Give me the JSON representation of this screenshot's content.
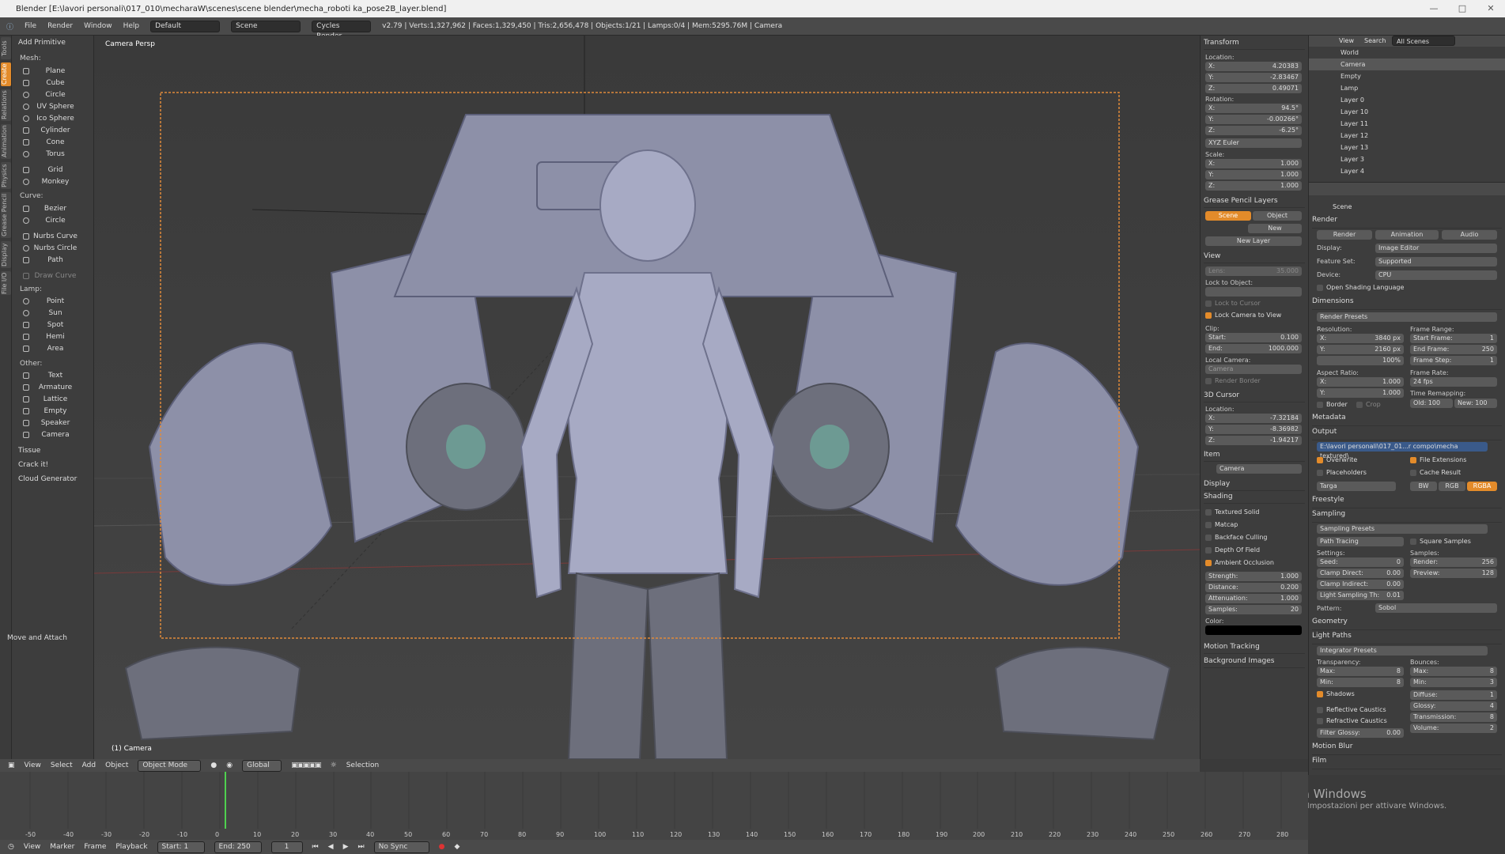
{
  "titlebar": {
    "text": "Blender [E:\\lavori personali\\017_010\\mecharaW\\scenes\\scene blender\\mecha_roboti ka_pose2B_layer.blend]"
  },
  "infobar": {
    "menus": [
      "File",
      "Render",
      "Window",
      "Help"
    ],
    "layout": "Default",
    "scene": "Scene",
    "engine": "Cycles Render",
    "stats": "v2.79 | Verts:1,327,962 | Faces:1,329,450 | Tris:2,656,478 | Objects:1/21 | Lamps:0/4 | Mem:5295.76M | Camera"
  },
  "tooltabs": [
    "Tools",
    "Create",
    "Relations",
    "Animation",
    "Physics",
    "Grease Pencil",
    "Display",
    "File I/O"
  ],
  "toolshelf": {
    "header": "Add Primitive",
    "mesh_label": "Mesh:",
    "mesh": [
      "Plane",
      "Cube",
      "Circle",
      "UV Sphere",
      "Ico Sphere",
      "Cylinder",
      "Cone",
      "Torus",
      "Grid",
      "Monkey"
    ],
    "curve_label": "Curve:",
    "curve": [
      "Bezier",
      "Circle",
      "Nurbs Curve",
      "Nurbs Circle",
      "Path",
      "Draw Curve"
    ],
    "lamp_label": "Lamp:",
    "lamp": [
      "Point",
      "Sun",
      "Spot",
      "Hemi",
      "Area"
    ],
    "other_label": "Other:",
    "other": [
      "Text",
      "Armature",
      "Lattice",
      "Empty",
      "Speaker",
      "Camera"
    ],
    "addons": [
      "Tissue",
      "Crack it!",
      "Cloud Generator"
    ],
    "bottom": "Move and Attach"
  },
  "viewport": {
    "label": "Camera Persp",
    "object": "(1) Camera"
  },
  "viewheader": {
    "items": [
      "View",
      "Select",
      "Add",
      "Object"
    ],
    "mode": "Object Mode",
    "orient": "Global",
    "selection": "Selection"
  },
  "props": {
    "transform": "Transform",
    "location_label": "Location:",
    "loc": [
      "4.20383",
      "-2.83467",
      "0.49071"
    ],
    "rotation_label": "Rotation:",
    "rot": [
      "94.5°",
      "-0.00266°",
      "-6.25°"
    ],
    "euler": "XYZ Euler",
    "scale_label": "Scale:",
    "scale": [
      "1.000",
      "1.000",
      "1.000"
    ],
    "grease": "Grease Pencil Layers",
    "gp_scene": "Scene",
    "gp_object": "Object",
    "gp_new": "New",
    "gp_newlayer": "New Layer",
    "view": "View",
    "lens": "Lens:",
    "lens_val": "35.000",
    "lock_obj": "Lock to Object:",
    "lock_cursor": "Lock to Cursor",
    "lock_cam": "Lock Camera to View",
    "clip": "Clip:",
    "clip_start": "Start:",
    "clip_start_v": "0.100",
    "clip_end": "End:",
    "clip_end_v": "1000.000",
    "local_cam": "Local Camera:",
    "local_cam_v": "Camera",
    "render_border": "Render Border",
    "cursor": "3D Cursor",
    "cursor_loc": "Location:",
    "cur": [
      "-7.32184",
      "-8.36982",
      "-1.94217"
    ],
    "item": "Item",
    "item_name": "Camera",
    "display": "Display",
    "shading": "Shading",
    "shade_opts": [
      "Textured Solid",
      "Matcap",
      "Backface Culling",
      "Depth Of Field",
      "Ambient Occlusion"
    ],
    "ao_strength": "Strength:",
    "ao_strength_v": "1.000",
    "ao_distance": "Distance:",
    "ao_distance_v": "0.200",
    "ao_atten": "Attenuation:",
    "ao_atten_v": "1.000",
    "ao_samples": "Samples:",
    "ao_samples_v": "20",
    "color": "Color:",
    "motion": "Motion Tracking",
    "bg": "Background Images"
  },
  "outliner": {
    "view": "View",
    "search": "Search",
    "scenes": "All Scenes",
    "rows": [
      "World",
      "Camera",
      "Empty",
      "Lamp",
      "Layer 0",
      "Layer 10",
      "Layer 11",
      "Layer 12",
      "Layer 13",
      "Layer 3",
      "Layer 4"
    ]
  },
  "render": {
    "scene": "Scene",
    "render": "Render",
    "btn_render": "Render",
    "btn_anim": "Animation",
    "btn_audio": "Audio",
    "display": "Display:",
    "display_v": "Image Editor",
    "feature": "Feature Set:",
    "feature_v": "Supported",
    "device": "Device:",
    "device_v": "CPU",
    "osl": "Open Shading Language",
    "dimensions": "Dimensions",
    "presets": "Render Presets",
    "resolution": "Resolution:",
    "res_x": "3840 px",
    "res_y": "2160 px",
    "res_pct": "100%",
    "frame_range": "Frame Range:",
    "start_frame": "Start Frame:",
    "start_frame_v": "1",
    "end_frame": "End Frame:",
    "end_frame_v": "250",
    "frame_step": "Frame Step:",
    "frame_step_v": "1",
    "aspect": "Aspect Ratio:",
    "asp_x": "1.000",
    "asp_y": "1.000",
    "frame_rate": "Frame Rate:",
    "fps": "24 fps",
    "remap": "Time Remapping:",
    "old": "Old: 100",
    "new": "New: 100",
    "border": "Border",
    "crop": "Crop",
    "metadata": "Metadata",
    "output": "Output",
    "output_path": "E:\\lavori personali\\017_01...r compo\\mecha textured\\",
    "overwrite": "Overwrite",
    "file_ext": "File Extensions",
    "placeholders": "Placeholders",
    "cache": "Cache Result",
    "format": "Targa",
    "bw": "BW",
    "rgb": "RGB",
    "rgba": "RGBA",
    "freestyle": "Freestyle",
    "sampling": "Sampling",
    "samp_presets": "Sampling Presets",
    "path_tracing": "Path Tracing",
    "square": "Square Samples",
    "settings": "Settings:",
    "samples": "Samples:",
    "seed": "Seed:",
    "seed_v": "0",
    "clamp_d": "Clamp Direct:",
    "clamp_d_v": "0.00",
    "clamp_i": "Clamp Indirect:",
    "clamp_i_v": "0.00",
    "light_th": "Light Sampling Th:",
    "light_th_v": "0.01",
    "s_render": "Render:",
    "s_render_v": "256",
    "s_preview": "Preview:",
    "s_preview_v": "128",
    "pattern": "Pattern:",
    "pattern_v": "Sobol",
    "geometry": "Geometry",
    "light_paths": "Light Paths",
    "int_presets": "Integrator Presets",
    "transparency": "Transparency:",
    "bounces": "Bounces:",
    "t_max": "Max:",
    "t_max_v": "8",
    "t_min": "Min:",
    "t_min_v": "8",
    "b_max": "Max:",
    "b_max_v": "8",
    "b_min": "Min:",
    "b_min_v": "3",
    "shadows": "Shadows",
    "diffuse": "Diffuse:",
    "diffuse_v": "1",
    "glossy": "Glossy:",
    "glossy_v": "4",
    "transmission": "Transmission:",
    "transmission_v": "8",
    "volume": "Volume:",
    "volume_v": "2",
    "refl_caustics": "Reflective Caustics",
    "refr_caustics": "Refractive Caustics",
    "filter_glossy": "Filter Glossy:",
    "filter_glossy_v": "0.00",
    "motion_blur": "Motion Blur",
    "film": "Film",
    "watermark1": "Attiva Windows",
    "watermark2": "Passa a Impostazioni per attivare Windows."
  },
  "timeline": {
    "ticks": [
      "-50",
      "-40",
      "-30",
      "-20",
      "-10",
      "0",
      "10",
      "20",
      "30",
      "40",
      "50",
      "60",
      "70",
      "80",
      "90",
      "100",
      "110",
      "120",
      "130",
      "140",
      "150",
      "160",
      "170",
      "180",
      "190",
      "200",
      "210",
      "220",
      "230",
      "240",
      "250",
      "260",
      "270",
      "280"
    ],
    "menus": [
      "View",
      "Marker",
      "Frame",
      "Playback"
    ],
    "start": "Start:",
    "start_v": "1",
    "end": "End:",
    "end_v": "250",
    "current": "1",
    "sync": "No Sync"
  }
}
